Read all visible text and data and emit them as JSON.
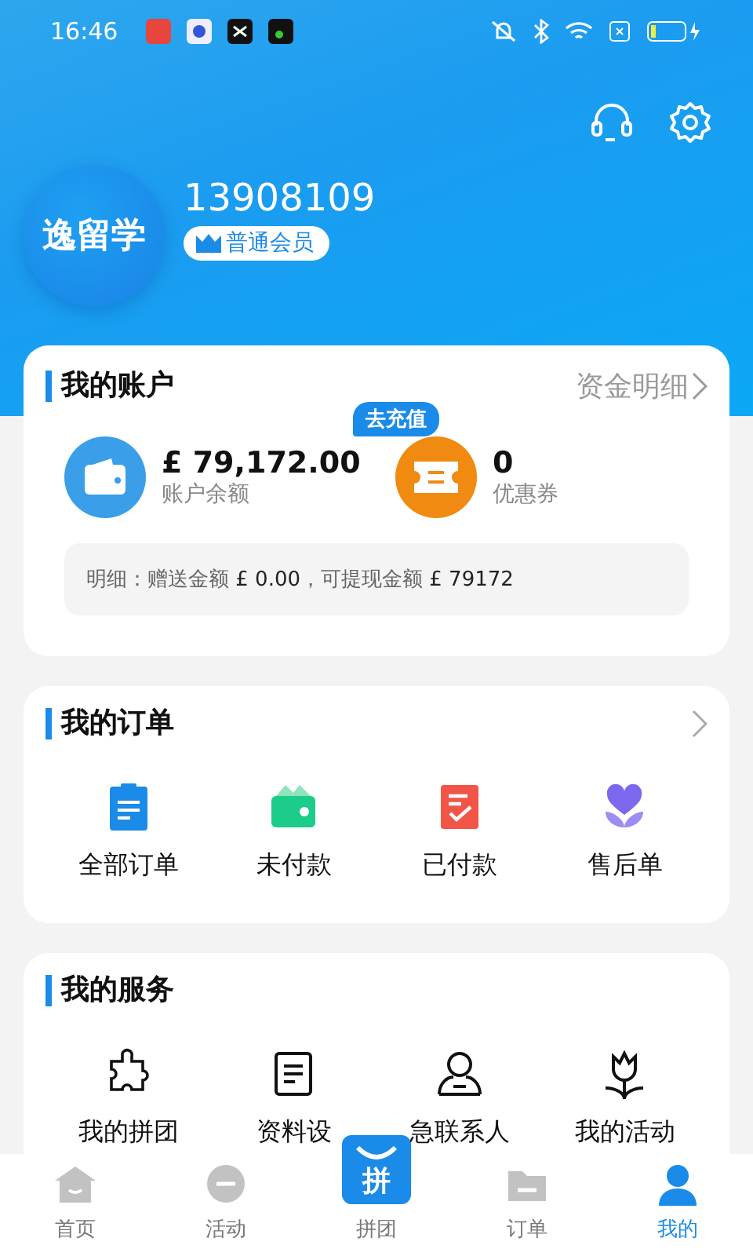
{
  "status_bar": {
    "time": "16:46"
  },
  "profile": {
    "avatar_text": "逸留学",
    "phone": "13908109",
    "membership": "普通会员"
  },
  "account": {
    "title": "我的账户",
    "link": "资金明细",
    "recharge_badge": "去充值",
    "stats": [
      {
        "kind": "wallet",
        "value": "£ 79,172.00",
        "label": "账户余额"
      },
      {
        "kind": "coupon",
        "value": "0",
        "label": "优惠券"
      }
    ],
    "detail": "明细：赠送金额 **£ 0.00**，可提现金额 **£ 79172**"
  },
  "orders": {
    "title": "我的订单",
    "items": [
      {
        "kind": "clipboard",
        "label": "全部订单"
      },
      {
        "kind": "wallet",
        "label": "未付款"
      },
      {
        "kind": "paid",
        "label": "已付款"
      },
      {
        "kind": "flower",
        "label": "售后单"
      }
    ]
  },
  "services": {
    "title": "我的服务",
    "items": [
      {
        "kind": "puzzle",
        "label": "我的拼团"
      },
      {
        "kind": "document",
        "label": "资料设"
      },
      {
        "kind": "person",
        "label": "急联系人"
      },
      {
        "kind": "tulip",
        "label": "我的活动"
      }
    ]
  },
  "tab_bar": [
    {
      "kind": "home",
      "label": "首页",
      "selected": false
    },
    {
      "kind": "activity",
      "label": "活动",
      "selected": false
    },
    {
      "kind": "group",
      "label": "拼团",
      "selected": false,
      "icon_text": "拼"
    },
    {
      "kind": "orders",
      "label": "订单",
      "selected": false
    },
    {
      "kind": "me",
      "label": "我的",
      "selected": true
    }
  ]
}
